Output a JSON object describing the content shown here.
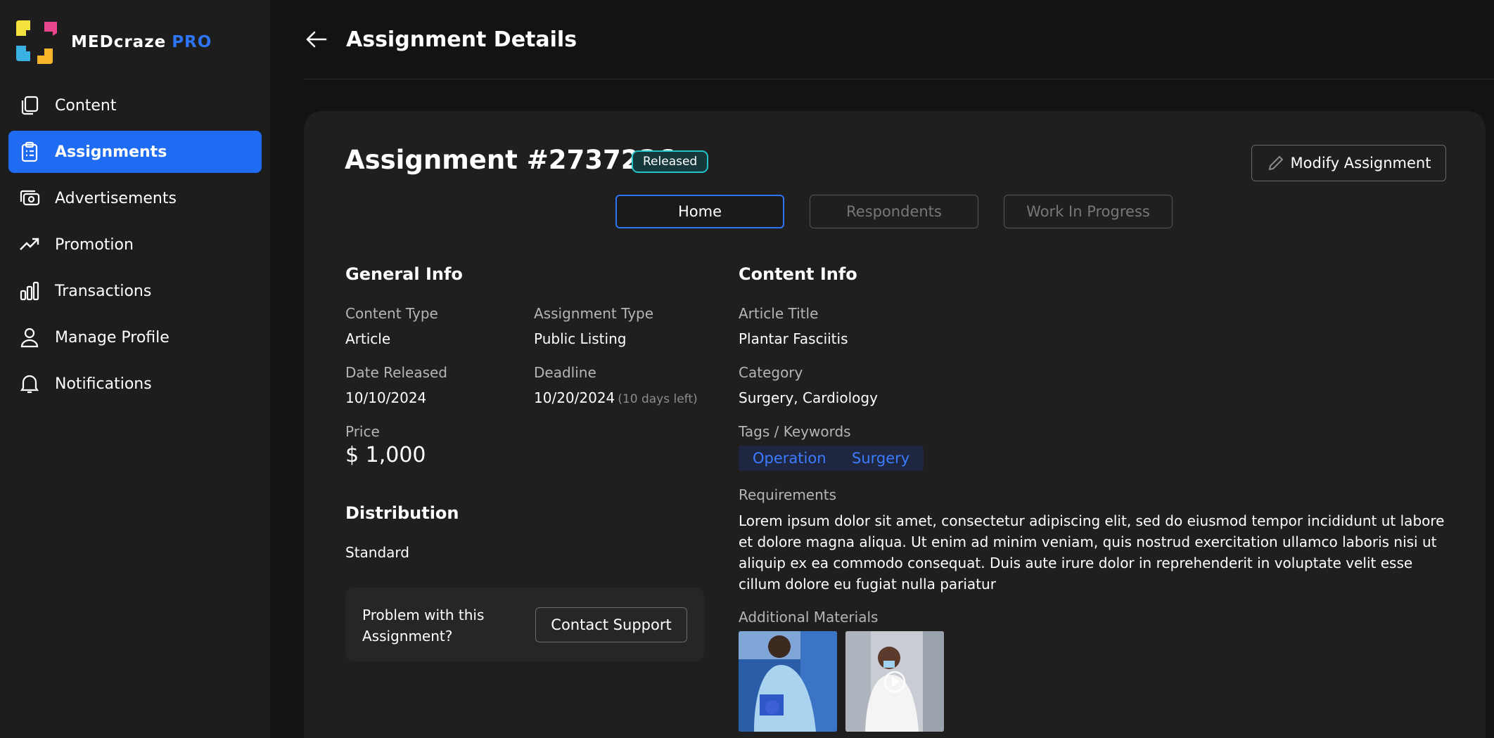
{
  "brand": {
    "name": "MEDcraze",
    "suffix": "PRO"
  },
  "nav": [
    {
      "label": "Content",
      "icon": "pages-icon",
      "active": false
    },
    {
      "label": "Assignments",
      "icon": "clipboard-icon",
      "active": true
    },
    {
      "label": "Advertisements",
      "icon": "money-icon",
      "active": false
    },
    {
      "label": "Promotion",
      "icon": "trending-up-icon",
      "active": false
    },
    {
      "label": "Transactions",
      "icon": "bar-chart-icon",
      "active": false
    },
    {
      "label": "Manage Profile",
      "icon": "user-icon",
      "active": false
    },
    {
      "label": "Notifications",
      "icon": "bell-icon",
      "active": false
    }
  ],
  "header": {
    "title": "Assignment Details"
  },
  "assignment": {
    "title": "Assignment #2737236",
    "status": "Released",
    "modify_label": "Modify Assignment"
  },
  "tabs": [
    {
      "label": "Home",
      "active": true
    },
    {
      "label": "Respondents",
      "active": false
    },
    {
      "label": "Work In Progress",
      "active": false
    }
  ],
  "general": {
    "title": "General Info",
    "content_type_label": "Content Type",
    "content_type": "Article",
    "assignment_type_label": "Assignment Type",
    "assignment_type": "Public Listing",
    "date_released_label": "Date Released",
    "date_released": "10/10/2024",
    "deadline_label": "Deadline",
    "deadline": "10/20/2024",
    "deadline_note": "(10 days left)",
    "price_label": "Price",
    "price": "$ 1,000"
  },
  "distribution": {
    "title": "Distribution",
    "value": "Standard"
  },
  "support": {
    "text": "Problem with this Assignment?",
    "button": "Contact Support"
  },
  "content": {
    "title": "Content Info",
    "article_title_label": "Article Title",
    "article_title": "Plantar Fasciitis",
    "category_label": "Category",
    "category": "Surgery, Cardiology",
    "tags_label": "Tags / Keywords",
    "tags": [
      "Operation",
      "Surgery"
    ],
    "requirements_label": "Requirements",
    "requirements": "Lorem ipsum dolor sit amet, consectetur adipiscing elit, sed do eiusmod tempor incididunt ut labore et dolore magna aliqua. Ut enim ad minim veniam, quis nostrud exercitation ullamco laboris nisi ut aliquip ex ea commodo consequat. Duis aute irure dolor in reprehenderit in voluptate velit esse cillum dolore eu fugiat nulla pariatur",
    "materials_label": "Additional Materials"
  },
  "colors": {
    "accent": "#1f6cf2",
    "badge_border": "#22c3c9",
    "tag_text": "#3c7cff"
  }
}
